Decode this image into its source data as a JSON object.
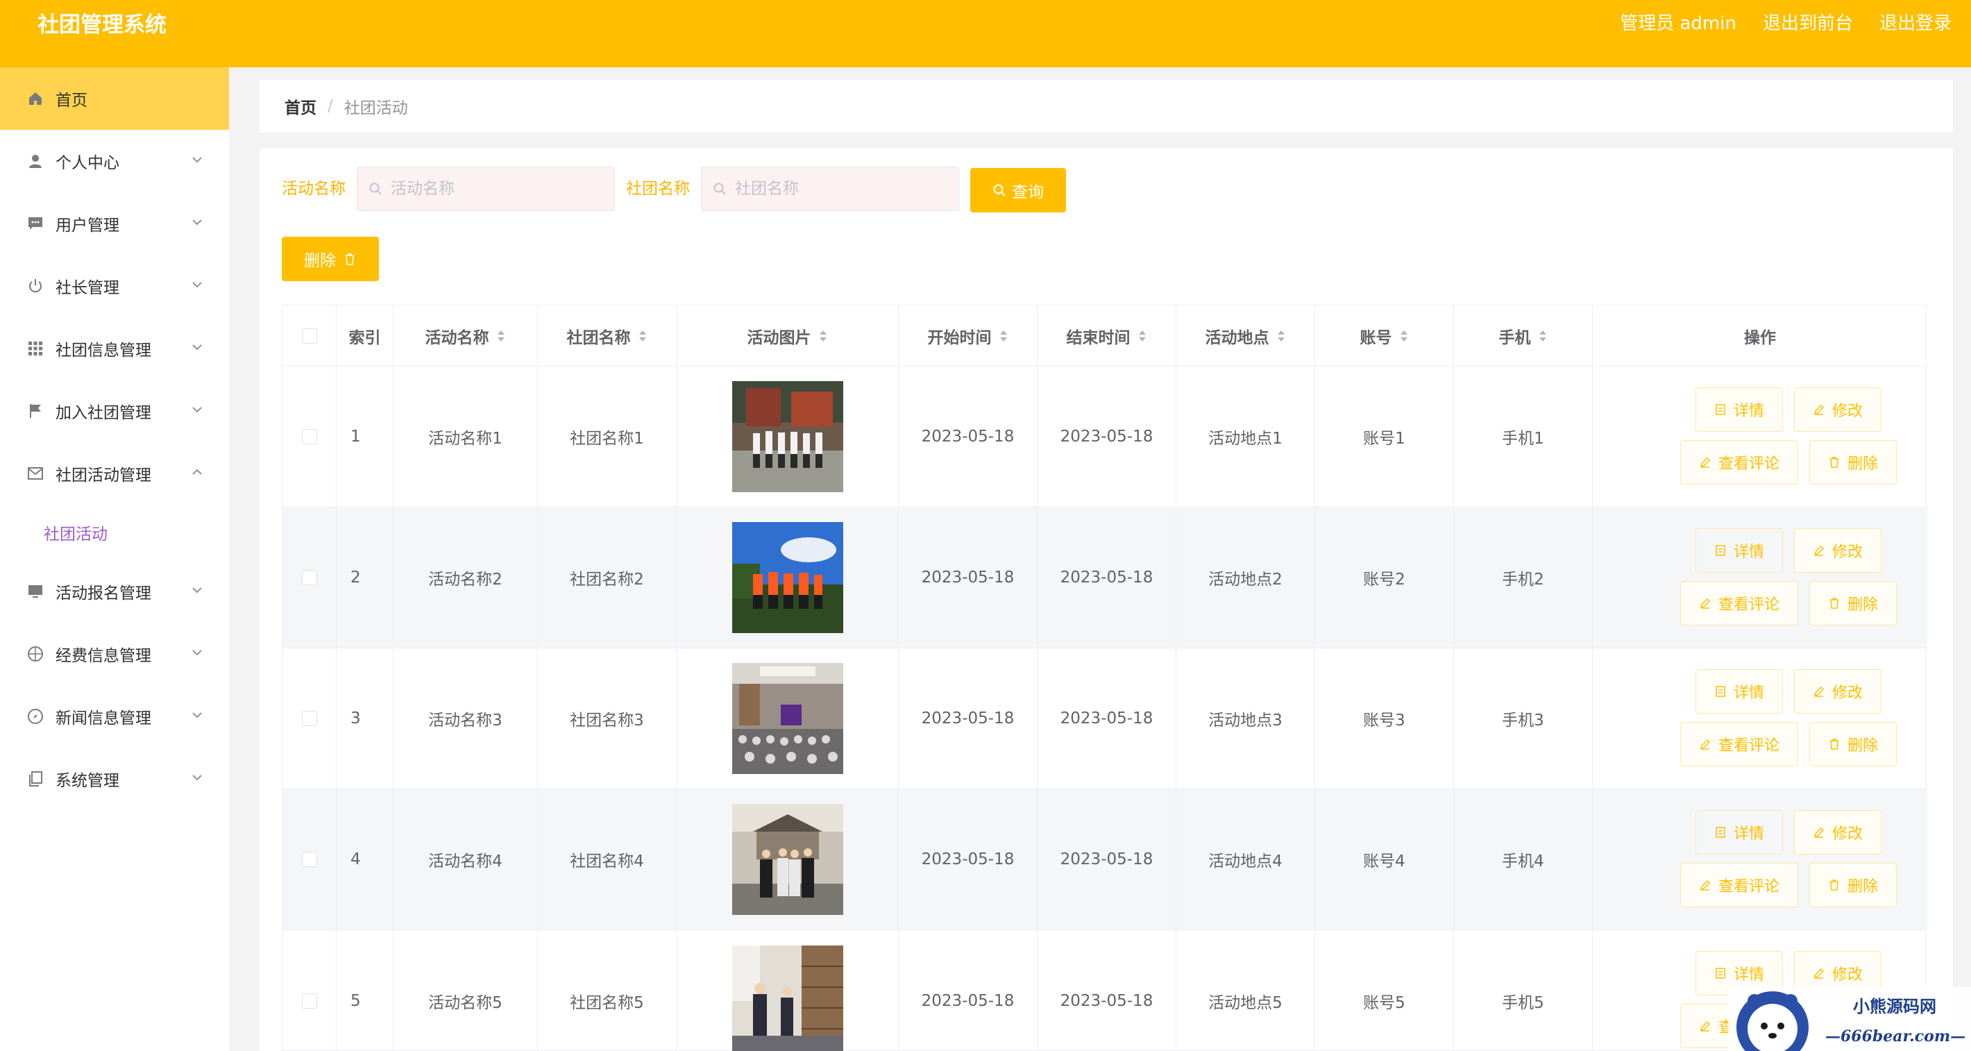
{
  "header": {
    "app_title": "社团管理系统",
    "admin_label": "管理员 admin",
    "front_link": "退出到前台",
    "logout_link": "退出登录"
  },
  "sidebar": {
    "items": [
      {
        "label": "首页",
        "icon": "home-icon",
        "active": true
      },
      {
        "label": "个人中心",
        "icon": "user-icon"
      },
      {
        "label": "用户管理",
        "icon": "chat-icon"
      },
      {
        "label": "社长管理",
        "icon": "power-icon"
      },
      {
        "label": "社团信息管理",
        "icon": "grid-icon"
      },
      {
        "label": "加入社团管理",
        "icon": "flag-icon"
      },
      {
        "label": "社团活动管理",
        "icon": "mail-icon",
        "expanded": true
      },
      {
        "label": "活动报名管理",
        "icon": "monitor-icon"
      },
      {
        "label": "经费信息管理",
        "icon": "aperture-icon"
      },
      {
        "label": "新闻信息管理",
        "icon": "compass-icon"
      },
      {
        "label": "系统管理",
        "icon": "copy-icon"
      }
    ],
    "submenu": {
      "label": "社团活动"
    }
  },
  "breadcrumb": {
    "home": "首页",
    "separator": "/",
    "current": "社团活动"
  },
  "search": {
    "activity_label": "活动名称",
    "activity_placeholder": "活动名称",
    "club_label": "社团名称",
    "club_placeholder": "社团名称",
    "query_button": "查询"
  },
  "toolbar": {
    "delete_button": "删除"
  },
  "table": {
    "headers": {
      "index": "索引",
      "activity_name": "活动名称",
      "club_name": "社团名称",
      "image": "活动图片",
      "start_time": "开始时间",
      "end_time": "结束时间",
      "location": "活动地点",
      "account": "账号",
      "phone": "手机",
      "actions": "操作"
    },
    "rows": [
      {
        "index": "1",
        "activity_name": "活动名称1",
        "club_name": "社团名称1",
        "start_time": "2023-05-18",
        "end_time": "2023-05-18",
        "location": "活动地点1",
        "account": "账号1",
        "phone": "手机1"
      },
      {
        "index": "2",
        "activity_name": "活动名称2",
        "club_name": "社团名称2",
        "start_time": "2023-05-18",
        "end_time": "2023-05-18",
        "location": "活动地点2",
        "account": "账号2",
        "phone": "手机2"
      },
      {
        "index": "3",
        "activity_name": "活动名称3",
        "club_name": "社团名称3",
        "start_time": "2023-05-18",
        "end_time": "2023-05-18",
        "location": "活动地点3",
        "account": "账号3",
        "phone": "手机3"
      },
      {
        "index": "4",
        "activity_name": "活动名称4",
        "club_name": "社团名称4",
        "start_time": "2023-05-18",
        "end_time": "2023-05-18",
        "location": "活动地点4",
        "account": "账号4",
        "phone": "手机4"
      },
      {
        "index": "5",
        "activity_name": "活动名称5",
        "club_name": "社团名称5",
        "start_time": "2023-05-18",
        "end_time": "2023-05-18",
        "location": "活动地点5",
        "account": "账号5",
        "phone": "手机5"
      }
    ],
    "actions": {
      "detail": "详情",
      "edit": "修改",
      "comments": "查看评论",
      "delete": "删除"
    }
  },
  "watermark": {
    "title": "小熊源码网",
    "url": "—666bear.com—"
  },
  "colors": {
    "accent": "#ffbf00",
    "active_menu": "#ffd34d",
    "submenu_text": "#9b59d0"
  }
}
